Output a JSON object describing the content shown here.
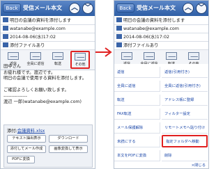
{
  "screen_title": "受信メール本文",
  "back_label": "Back",
  "subject": "明日の会議の資料を添付します",
  "from": "watanabe@example.com",
  "date": "2014-08-06(水)17:02",
  "attachment_note": "添付ファイルあり",
  "toolbar": [
    "返信",
    "全員に返信",
    "転送",
    "その他"
  ],
  "body_lines": [
    "田中さん",
    "お疲れ様です。渡辺です。",
    "明日の会議で使用する資料を添付します。",
    "",
    "ご確認よろしくお願い致します。",
    "---------------",
    "渡辺 一郎(watanabe@example.com)"
  ],
  "attachment": {
    "label": "添付:",
    "file": "会議資料.xlsx",
    "buttons": [
      "テキスト抽出表示",
      "ダウンロード",
      "添付してメール作成",
      "画像変換して表示",
      "PDFに変換"
    ]
  },
  "menu": {
    "left": [
      "返信",
      "全員に返信",
      "転送",
      "FAX転送",
      "メール保護解除",
      "未読にする",
      "本文をPDFに変換"
    ],
    "right": [
      "返信(引用付き)",
      "全員に返信(引用付き)",
      "アドレス帳に登録",
      "フィルター設定",
      "リモートメモへ貼り付け",
      "指定フォルダへ移動",
      "削除"
    ],
    "return_label": "×閉じる"
  },
  "colors": {
    "header": "#2f5fa6",
    "highlight": "#e02020",
    "link": "#1a46a8"
  }
}
